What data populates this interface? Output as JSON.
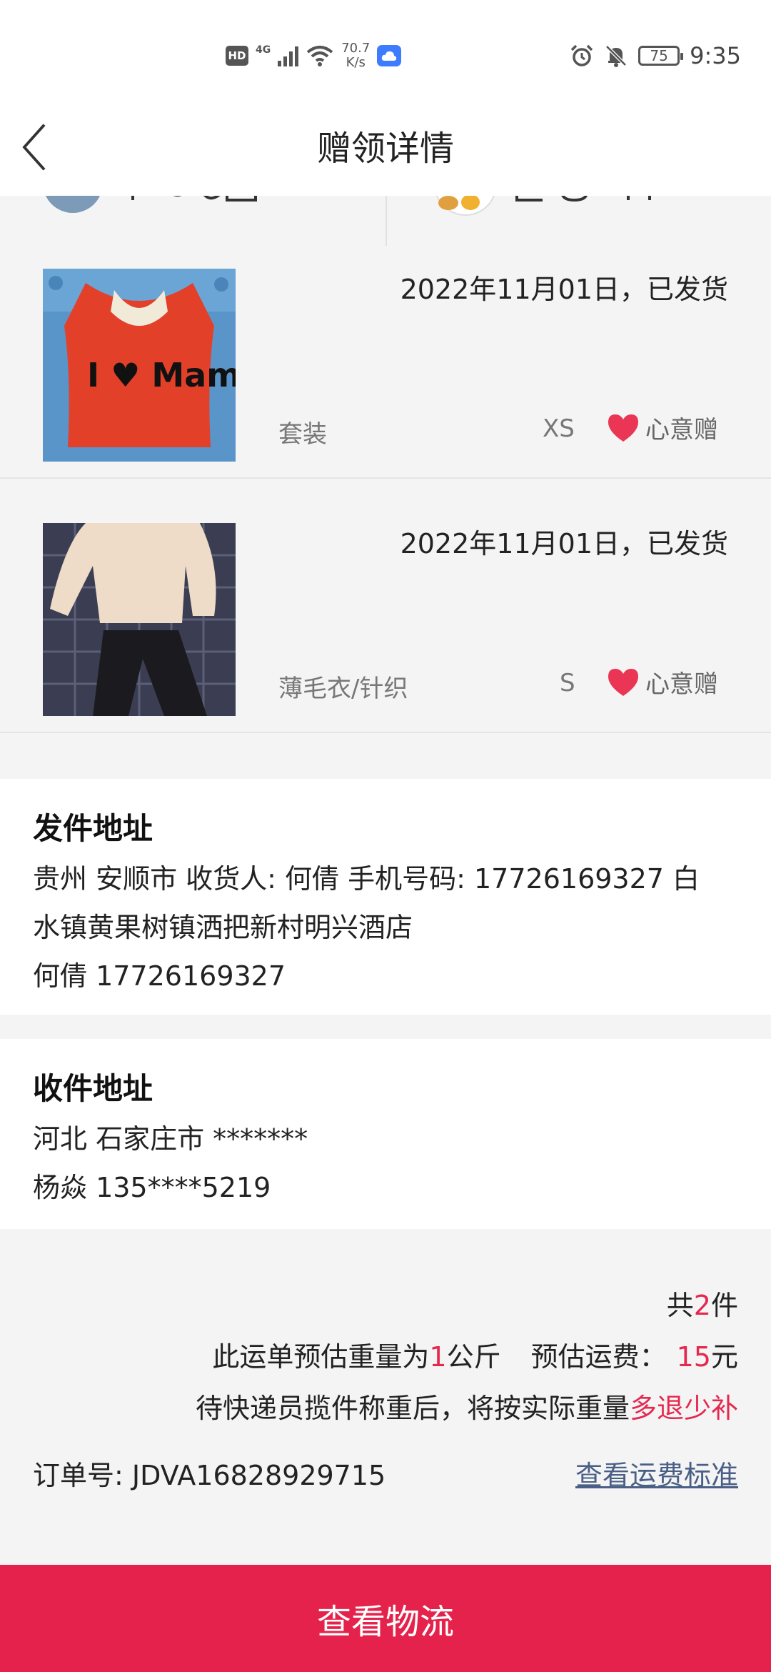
{
  "status_bar": {
    "hd": "HD",
    "network": "4G",
    "speed_value": "70.7",
    "speed_unit": "K/s",
    "battery": "75",
    "time": "9:35"
  },
  "header": {
    "title": "赠领详情",
    "back_icon": "chevron-left-icon"
  },
  "items": [
    {
      "date_status": "2022年11月01日，已发货",
      "category": "套装",
      "size": "XS",
      "gift_type": "心意赠",
      "photo_caption": "I ♥ Mama"
    },
    {
      "date_status": "2022年11月01日，已发货",
      "category": "薄毛衣/针织",
      "size": "S",
      "gift_type": "心意赠"
    }
  ],
  "sender": {
    "title": "发件地址",
    "address_line1": "贵州 安顺市 收货人: 何倩 手机号码: 17726169327 白",
    "address_line2": "水镇黄果树镇洒把新村明兴酒店",
    "contact": "何倩 17726169327"
  },
  "receiver": {
    "title": "收件地址",
    "address": "河北 石家庄市 *******",
    "contact": "杨焱 135****5219"
  },
  "summary": {
    "count_prefix": "共",
    "count_value": "2",
    "count_suffix": "件",
    "weight_prefix": "此运单预估重量为",
    "weight_value": "1",
    "weight_suffix": "公斤",
    "fee_prefix": "预估运费：",
    "fee_value": "15",
    "fee_suffix": "元",
    "note_prefix": "待快递员揽件称重后，将按实际重量",
    "note_highlight": "多退少补",
    "order_label": "订单号:",
    "order_number": "JDVA16828929715",
    "fee_link": "查看运费标准"
  },
  "bottom_button": "查看物流",
  "colors": {
    "accent": "#e5224b",
    "link": "#4a5f86",
    "background": "#f4f4f4"
  }
}
